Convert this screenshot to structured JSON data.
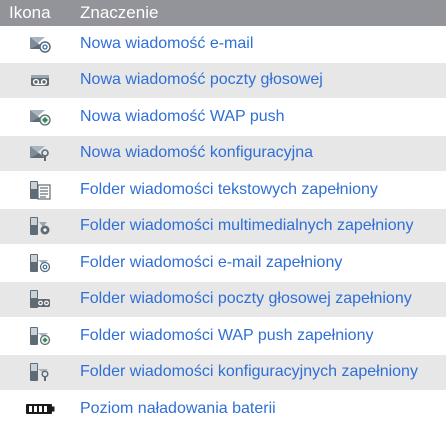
{
  "header": {
    "col_icon": "Ikona",
    "col_meaning": "Znaczenie"
  },
  "colors": {
    "header_bg": "#93949a",
    "row_alt_bg": "#e7e7e7",
    "text_blue": "#2f6fd6"
  },
  "rows": [
    {
      "icon": "new-email-icon",
      "label": "Nowa wiadomość e-mail"
    },
    {
      "icon": "new-voicemail-icon",
      "label": "Nowa wiadomość poczty głosowej"
    },
    {
      "icon": "new-wap-push-icon",
      "label": "Nowa wiadomość WAP push"
    },
    {
      "icon": "new-config-message-icon",
      "label": "Nowa wiadomość konfiguracyjna"
    },
    {
      "icon": "sms-folder-full-icon",
      "label": "Folder wiadomości tekstowych zapełniony"
    },
    {
      "icon": "mms-folder-full-icon",
      "label": "Folder wiadomości multimedialnych zapełniony"
    },
    {
      "icon": "email-folder-full-icon",
      "label": "Folder wiadomości e-mail zapełniony"
    },
    {
      "icon": "voicemail-folder-full-icon",
      "label": "Folder wiadomości poczty głosowej zapełniony"
    },
    {
      "icon": "wap-push-folder-full-icon",
      "label": "Folder wiadomości WAP push zapełniony"
    },
    {
      "icon": "config-folder-full-icon",
      "label": "Folder wiadomości konfiguracyjnych zapełniony"
    },
    {
      "icon": "battery-level-icon",
      "label": "Poziom naładowania baterii"
    }
  ]
}
